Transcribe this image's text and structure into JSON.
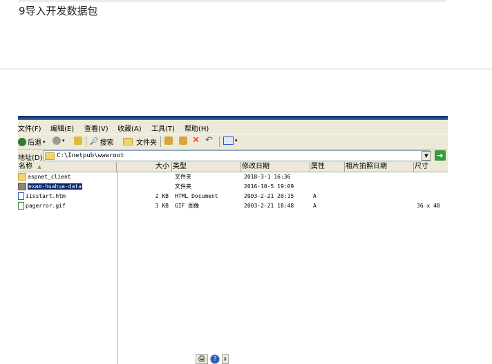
{
  "article": {
    "heading": "9导入开发数据包"
  },
  "explorer": {
    "menu": [
      "文件(F)",
      "编辑(E)",
      "查看(V)",
      "收藏(A)",
      "工具(T)",
      "帮助(H)"
    ],
    "toolbar": {
      "back": "后退",
      "search": "搜索",
      "folders": "文件夹"
    },
    "address": {
      "label": "地址(D)",
      "value": "C:\\Inetpub\\wwwroot"
    },
    "columns": [
      "名称",
      "大小",
      "类型",
      "修改日期",
      "属性",
      "相片拍照日期",
      "尺寸"
    ],
    "files": [
      {
        "name": "aspnet_client",
        "size": "",
        "type": "文件夹",
        "modified": "2018-3-1 16:36",
        "attr": "",
        "dims": "",
        "icon": "folder-icon"
      },
      {
        "name": "exam-huahua-data",
        "size": "",
        "type": "文件夹",
        "modified": "2016-10-5 19:09",
        "attr": "",
        "dims": "",
        "icon": "folder-icon"
      },
      {
        "name": "iisstart.htm",
        "size": "2 KB",
        "type": "HTML Document",
        "modified": "2003-2-21 20:15",
        "attr": "A",
        "dims": "",
        "icon": "html-file-icon"
      },
      {
        "name": "pagerror.gif",
        "size": "3 KB",
        "type": "GIF 图像",
        "modified": "2003-2-21 18:48",
        "attr": "A",
        "dims": "36 x 48",
        "icon": "gif-file-icon"
      }
    ],
    "colors": {
      "accent": "#0a246a",
      "chrome": "#ece9d8",
      "folder": "#f5d36b"
    }
  }
}
